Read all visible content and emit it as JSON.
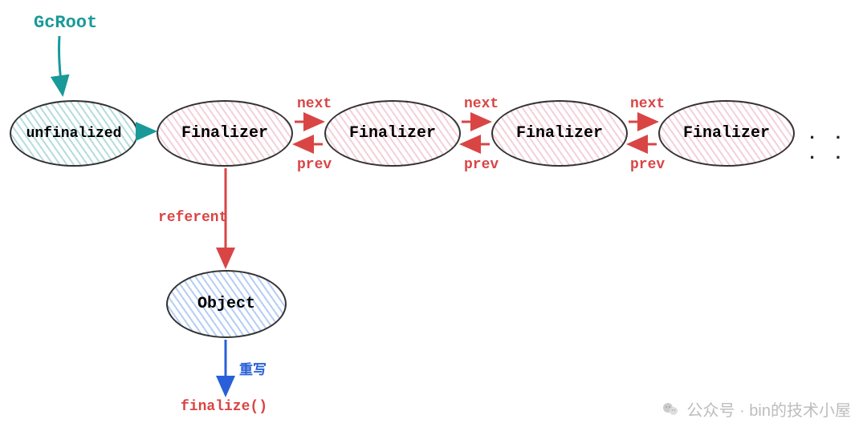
{
  "nodes": {
    "gcroot": "GcRoot",
    "unfinalized": "unfinalized",
    "finalizer1": "Finalizer",
    "finalizer2": "Finalizer",
    "finalizer3": "Finalizer",
    "finalizer4": "Finalizer",
    "object": "Object",
    "dots": ". . . ."
  },
  "edges": {
    "next12": "next",
    "prev12": "prev",
    "next23": "next",
    "prev23": "prev",
    "next34": "next",
    "prev34": "prev",
    "referent": "referent",
    "override": "重写",
    "finalize": "finalize()"
  },
  "colors": {
    "teal": "#1a9999",
    "red": "#d94545",
    "blue": "#2960d9",
    "black": "#222222"
  },
  "watermark": "公众号 · bin的技术小屋"
}
